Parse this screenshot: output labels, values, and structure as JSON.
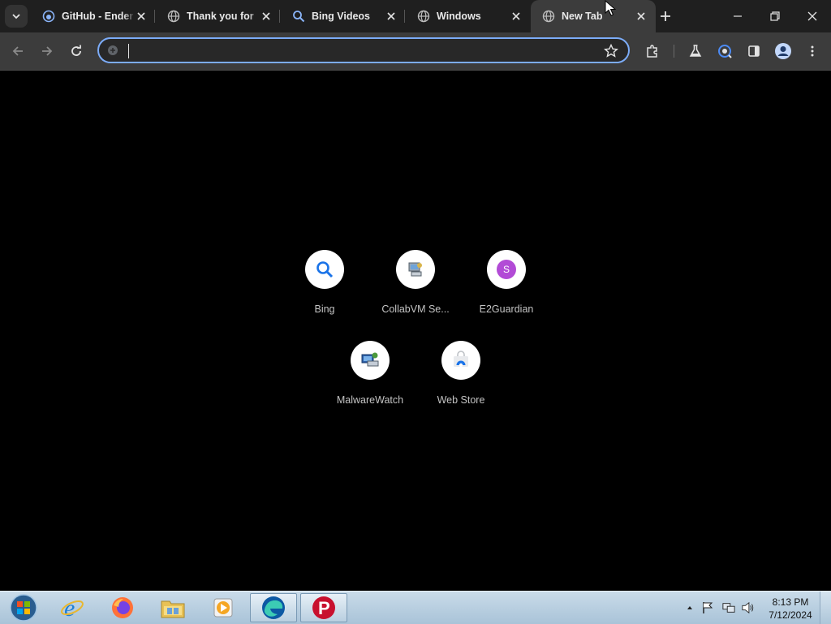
{
  "tabs": [
    {
      "title": "GitHub - Ender",
      "favicon": "github-icon"
    },
    {
      "title": "Thank you for",
      "favicon": "globe-icon"
    },
    {
      "title": "Bing Videos",
      "favicon": "search-icon"
    },
    {
      "title": "Windows",
      "favicon": "globe-icon"
    },
    {
      "title": "New Tab",
      "favicon": "globe-icon",
      "active": true
    }
  ],
  "omnibox": {
    "value": "",
    "placeholder": ""
  },
  "shortcuts": [
    {
      "label": "Bing",
      "icon": "search-icon"
    },
    {
      "label": "CollabVM Se...",
      "icon": "computer-icon"
    },
    {
      "label": "E2Guardian",
      "icon": "letter-s-icon",
      "letter": "S"
    },
    {
      "label": "MalwareWatch",
      "icon": "computer-icon"
    },
    {
      "label": "Web Store",
      "icon": "web-store-icon"
    }
  ],
  "taskbar": {
    "apps": [
      "start-orb",
      "internet-explorer-icon",
      "firefox-icon",
      "file-explorer-icon",
      "media-player-icon",
      "edge-icon",
      "psiphon-icon"
    ],
    "clock": {
      "time": "8:13 PM",
      "date": "7/12/2024"
    }
  },
  "colors": {
    "accent": "#7cacf8",
    "tab_strip": "#1f1f1f",
    "toolbar": "#3c3c3c",
    "page_bg": "#000000",
    "e2guardian": "#b24bd6"
  }
}
